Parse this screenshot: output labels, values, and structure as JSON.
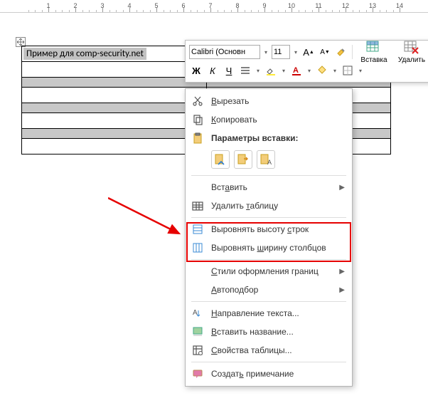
{
  "ruler": {
    "marks": [
      1,
      2,
      3,
      4,
      5,
      6,
      7,
      8,
      9,
      10,
      11,
      12,
      13,
      14
    ]
  },
  "table": {
    "sample_text": "Пример для comp-security.net"
  },
  "mini_toolbar": {
    "font_name": "Calibri (Основн",
    "font_size": "11",
    "buttons": {
      "grow_font": "A",
      "shrink_font": "A",
      "format_painter": "brush",
      "bold": "Ж",
      "italic": "К",
      "underline": "Ч",
      "insert_label": "Вставка",
      "delete_label": "Удалить"
    }
  },
  "context_menu": {
    "cut": "Вырезать",
    "copy": "Копировать",
    "paste_options_heading": "Параметры вставки:",
    "insert_submenu": "Вставить",
    "delete_table": "Удалить таблицу",
    "distribute_rows": "Выровнять высоту строк",
    "distribute_cols": "Выровнять ширину столбцов",
    "border_styles": "Стили оформления границ",
    "autofit": "Автоподбор",
    "text_direction": "Направление текста...",
    "insert_caption": "Вставить название...",
    "table_properties": "Свойства таблицы...",
    "new_comment": "Создать примечание"
  }
}
